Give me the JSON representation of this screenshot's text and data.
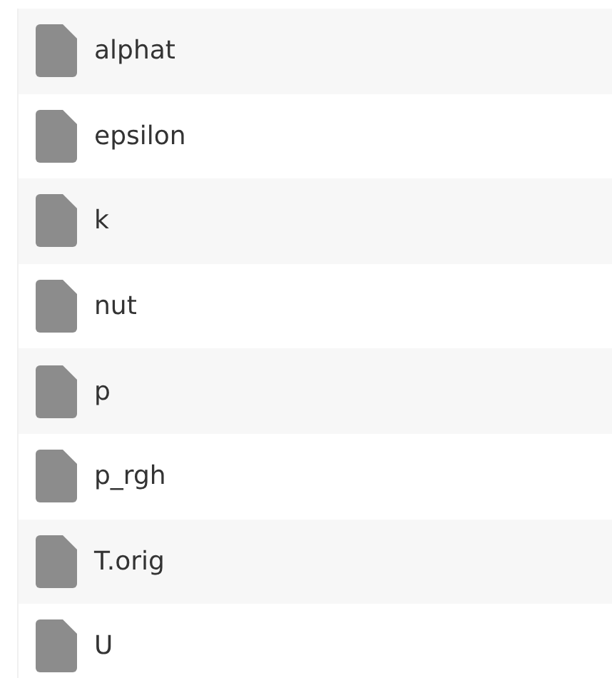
{
  "files": [
    {
      "name": "alphat"
    },
    {
      "name": "epsilon"
    },
    {
      "name": "k"
    },
    {
      "name": "nut"
    },
    {
      "name": "p"
    },
    {
      "name": "p_rgh"
    },
    {
      "name": "T.orig"
    },
    {
      "name": "U"
    }
  ]
}
